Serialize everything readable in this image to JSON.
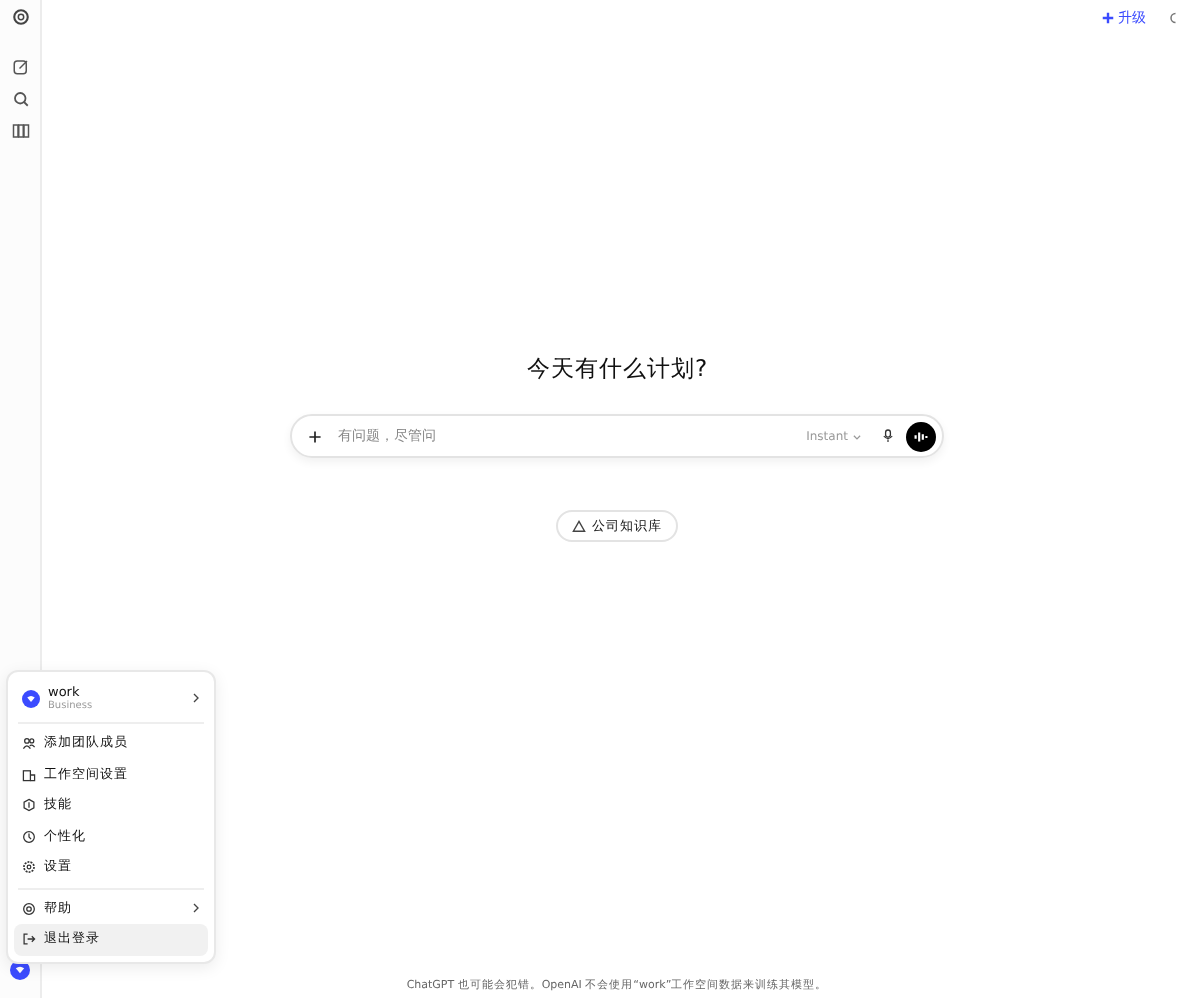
{
  "top_bar": {
    "upgrade_label": "升级"
  },
  "main": {
    "heading": "今天有什么计划?",
    "composer": {
      "placeholder": "有问题，尽管问",
      "model": "Instant"
    },
    "chip": "公司知识库"
  },
  "account_menu": {
    "workspace": {
      "name": "work",
      "plan": "Business",
      "has_submenu": true
    },
    "groups": [
      [
        {
          "label": "添加团队成员",
          "has_submenu": false,
          "selected": false
        },
        {
          "label": "工作空间设置",
          "has_submenu": false,
          "selected": false
        },
        {
          "label": "技能",
          "has_submenu": false,
          "selected": false
        },
        {
          "label": "个性化",
          "has_submenu": false,
          "selected": false
        },
        {
          "label": "设置",
          "has_submenu": false,
          "selected": false
        }
      ],
      [
        {
          "label": "帮助",
          "has_submenu": true,
          "selected": false
        },
        {
          "label": "退出登录",
          "has_submenu": false,
          "selected": true
        }
      ]
    ]
  },
  "footer": "ChatGPT 也可能会犯错。OpenAI 不会使用“work”工作空间数据来训练其模型。"
}
